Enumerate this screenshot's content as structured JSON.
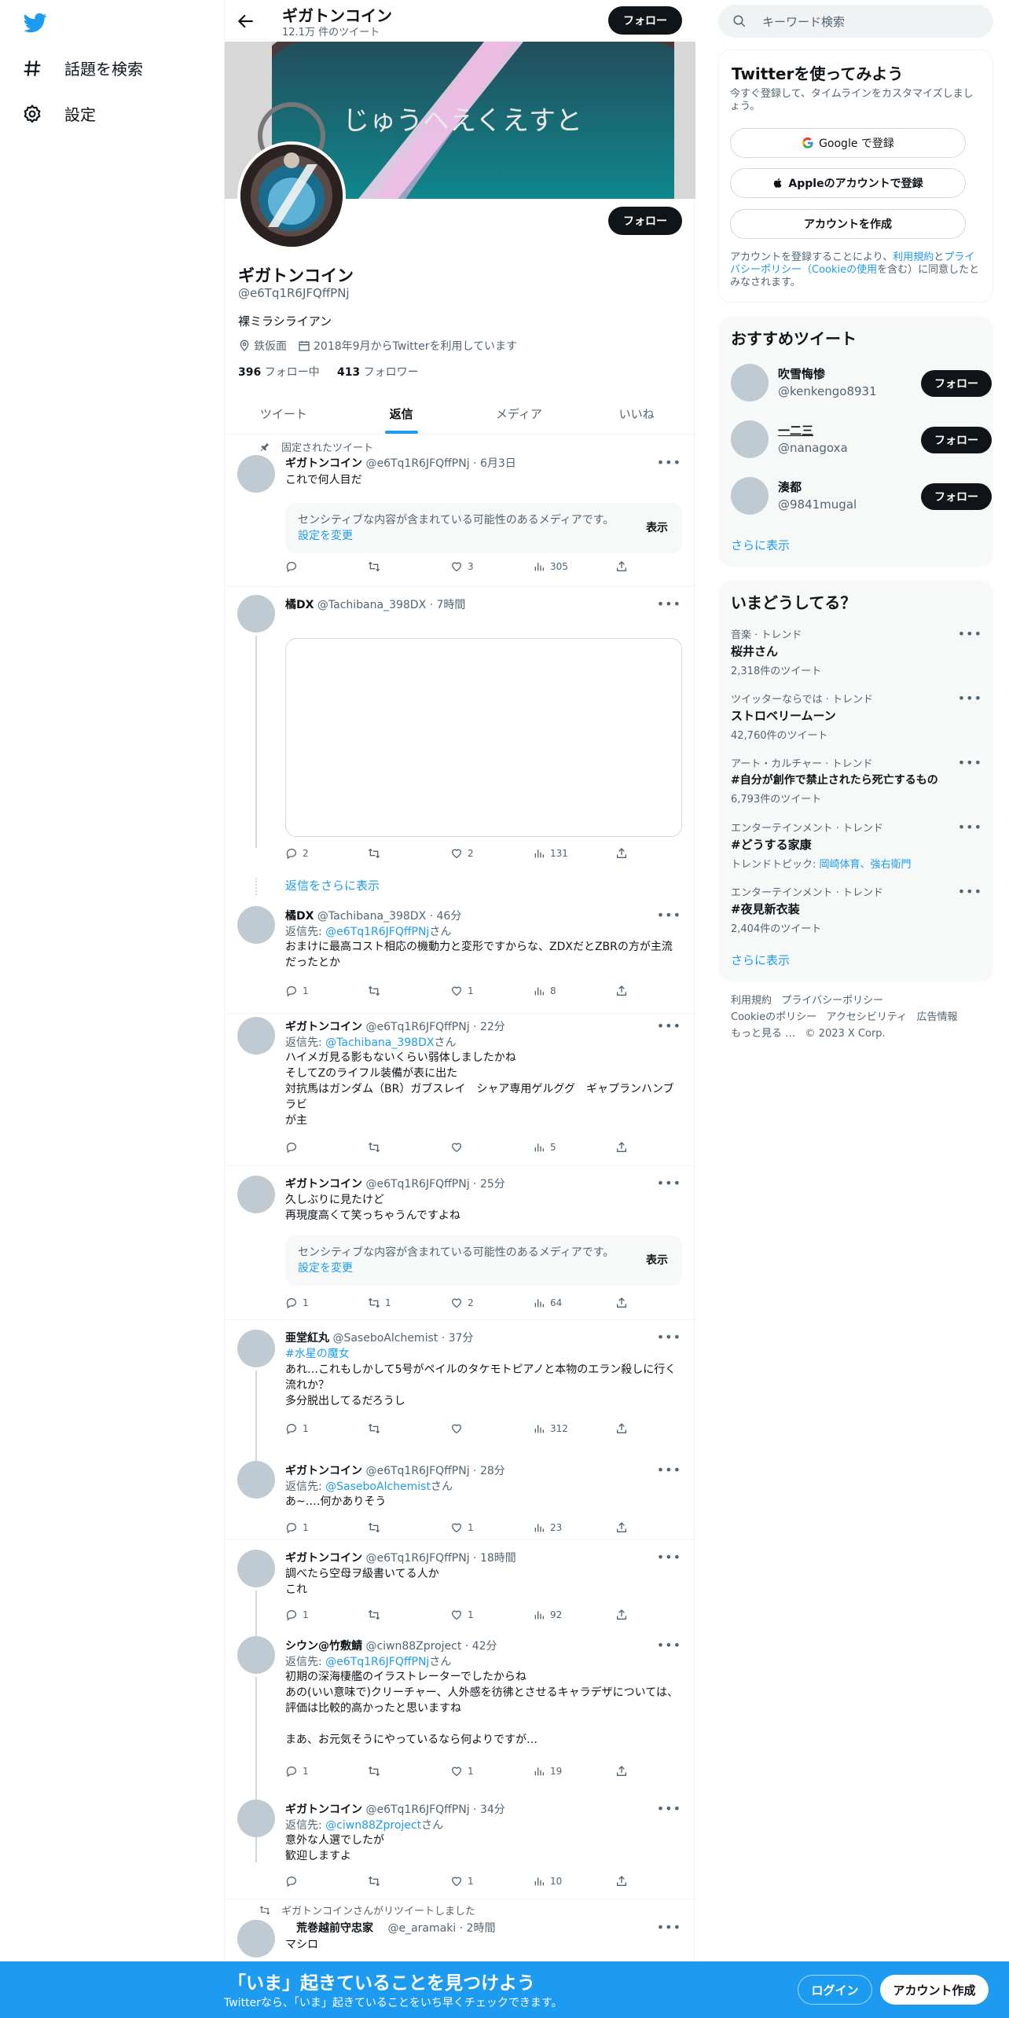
{
  "nav": {
    "search_label": "話題を検索",
    "settings_label": "設定"
  },
  "header": {
    "name": "ギガトンコイン",
    "tweet_count": "12.1万 件のツイート",
    "follow": "フォロー"
  },
  "banner_text": "じゅうへえくえすと",
  "profile": {
    "name": "ギガトンコイン",
    "handle": "@e6Tq1R6JFQffPNj",
    "bio": "裸ミラシライアン",
    "location": "鉄仮面",
    "joined": "2018年9月からTwitterを利用しています",
    "following_count": "396",
    "following_label": "フォロー中",
    "followers_count": "413",
    "followers_label": "フォロワー",
    "follow": "フォロー"
  },
  "tabs": [
    "ツイート",
    "返信",
    "メディア",
    "いいね"
  ],
  "sensitive": {
    "text": "センシティブな内容が含まれている可能性のあるメディアです。",
    "link": "設定を変更",
    "show": "表示"
  },
  "replyto_label": "返信先:",
  "replyto_suffix": "さん",
  "tweets": [
    {
      "pinned": "固定されたツイート",
      "name": "ギガトンコイン",
      "meta": "@e6Tq1R6JFQffPNj · 6月3日",
      "text": "これで何人目だ",
      "reply": "",
      "retweet": "",
      "like": "3",
      "views": "305"
    },
    {
      "name": "橘DX",
      "meta": "@Tachibana_398DX · 7時間",
      "reply": "2",
      "retweet": "",
      "like": "2",
      "views": "131",
      "showmore": "返信をさらに表示"
    },
    {
      "name": "橘DX",
      "meta": "@Tachibana_398DX · 46分",
      "replyto": "@e6Tq1R6JFQffPNj",
      "text": "おまけに最高コスト相応の機動力と変形ですからな、ZDXだとZBRの方が主流だったとか",
      "reply": "1",
      "retweet": "",
      "like": "1",
      "views": "8"
    },
    {
      "name": "ギガトンコイン",
      "meta": "@e6Tq1R6JFQffPNj · 22分",
      "replyto": "@Tachibana_398DX",
      "text": "ハイメガ見る影もないくらい弱体しましたかね\nそしてZのライフル装備が表に出た\n対抗馬はガンダム（BR）ガブスレイ　シャア専用ゲルググ　ギャプランハンブラビ\nが主",
      "reply": "",
      "retweet": "",
      "like": "",
      "views": "5"
    },
    {
      "name": "ギガトンコイン",
      "meta": "@e6Tq1R6JFQffPNj · 25分",
      "text": "久しぶりに見たけど\n再現度高くて笑っちゃうんですよね",
      "reply": "1",
      "retweet": "1",
      "like": "2",
      "views": "64"
    },
    {
      "name": "亜堂紅丸",
      "meta": "@SaseboAlchemist · 37分",
      "hashtag": "#水星の魔女",
      "text": "あれ…これもしかして5号がペイルのタケモトピアノと本物のエラン殺しに行く流れか？\n多分脱出してるだろうし",
      "reply": "1",
      "retweet": "",
      "like": "",
      "views": "312"
    },
    {
      "name": "ギガトンコイン",
      "meta": "@e6Tq1R6JFQffPNj · 28分",
      "replyto": "@SaseboAlchemist",
      "text": "あ~‥‥何かありそう",
      "reply": "1",
      "retweet": "",
      "like": "1",
      "views": "23"
    },
    {
      "name": "ギガトンコイン",
      "meta": "@e6Tq1R6JFQffPNj · 18時間",
      "text": "調べたら空母ヲ級書いてる人か\nこれ",
      "reply": "1",
      "retweet": "",
      "like": "1",
      "views": "92"
    },
    {
      "name": "シウン@竹敷鯖",
      "meta": "@ciwn88Zproject · 42分",
      "replyto": "@e6Tq1R6JFQffPNj",
      "text": "初期の深海棲艦のイラストレーターでしたからね\nあの(いい意味で)クリーチャー、人外感を彷彿とさせるキャラデザについては、評価は比較的高かったと思いますね\n\nまあ、お元気そうにやっているなら何よりですが…",
      "reply": "1",
      "retweet": "",
      "like": "1",
      "views": "19"
    },
    {
      "name": "ギガトンコイン",
      "meta": "@e6Tq1R6JFQffPNj · 34分",
      "replyto": "@ciwn88Zproject",
      "text": "意外な人選でしたが\n歓迎しますよ",
      "reply": "",
      "retweet": "",
      "like": "1",
      "views": "10"
    },
    {
      "retweeted": "ギガトンコインさんがリツイートしました",
      "name": "　荒巻越前守忠家",
      "meta": "　@e_aramaki · 2時間",
      "text": "マシロ"
    }
  ],
  "right": {
    "search_placeholder": "キーワード検索",
    "join": {
      "title": "Twitterを使ってみよう",
      "sub": "今すぐ登録して、タイムラインをカスタマイズしましょう。",
      "google": "Google で登録",
      "apple": "Appleのアカウントで登録",
      "create": "アカウントを作成",
      "terms_pre": "アカウントを登録することにより、",
      "terms_link1": "利用規約",
      "terms_mid": "と",
      "terms_link2": "プライバシーポリシー（Cookieの使用",
      "terms_post": "を含む）に同意したとみなされます。"
    },
    "rec": {
      "title": "おすすめツイート",
      "users": [
        {
          "name": "吹雪悔惨",
          "handle": "@kenkengo8931"
        },
        {
          "name": "一二三",
          "handle": "@nanagoxa"
        },
        {
          "name": "湊都",
          "handle": "@9841mugal"
        }
      ],
      "follow": "フォロー",
      "more": "さらに表示"
    },
    "trends": {
      "title": "いまどうしてる？",
      "items": [
        {
          "cat": "音楽 · トレンド",
          "title": "桜井さん",
          "count": "2,318件のツイート"
        },
        {
          "cat": "ツイッターならでは · トレンド",
          "title": "ストロベリームーン",
          "count": "42,760件のツイート"
        },
        {
          "cat": "アート・カルチャー · トレンド",
          "title": "#自分が創作で禁止されたら死亡するもの",
          "count": "6,793件のツイート"
        },
        {
          "cat": "エンターテインメント · トレンド",
          "title": "#どうする家康",
          "count_pre": "トレンドトピック: ",
          "count_link": "岡崎体育、強右衛門"
        },
        {
          "cat": "エンターテインメント · トレンド",
          "title": "#夜見新衣装",
          "count": "2,404件のツイート"
        }
      ],
      "more": "さらに表示"
    },
    "footer": {
      "terms": "利用規約",
      "privacy": "プライバシーポリシー",
      "cookie": "Cookieのポリシー",
      "access": "アクセシビリティ",
      "ads": "広告情報",
      "more": "もっと見る …",
      "copyright": "© 2023 X Corp."
    }
  },
  "bottom": {
    "title": "「いま」起きていることを見つけよう",
    "sub": "Twitterなら、「いま」起きていることをいち早くチェックできます。",
    "login": "ログイン",
    "signup": "アカウント作成"
  },
  "colors": {
    "accent": "#1d9bf0",
    "text": "#0f1419",
    "muted": "#536471"
  }
}
